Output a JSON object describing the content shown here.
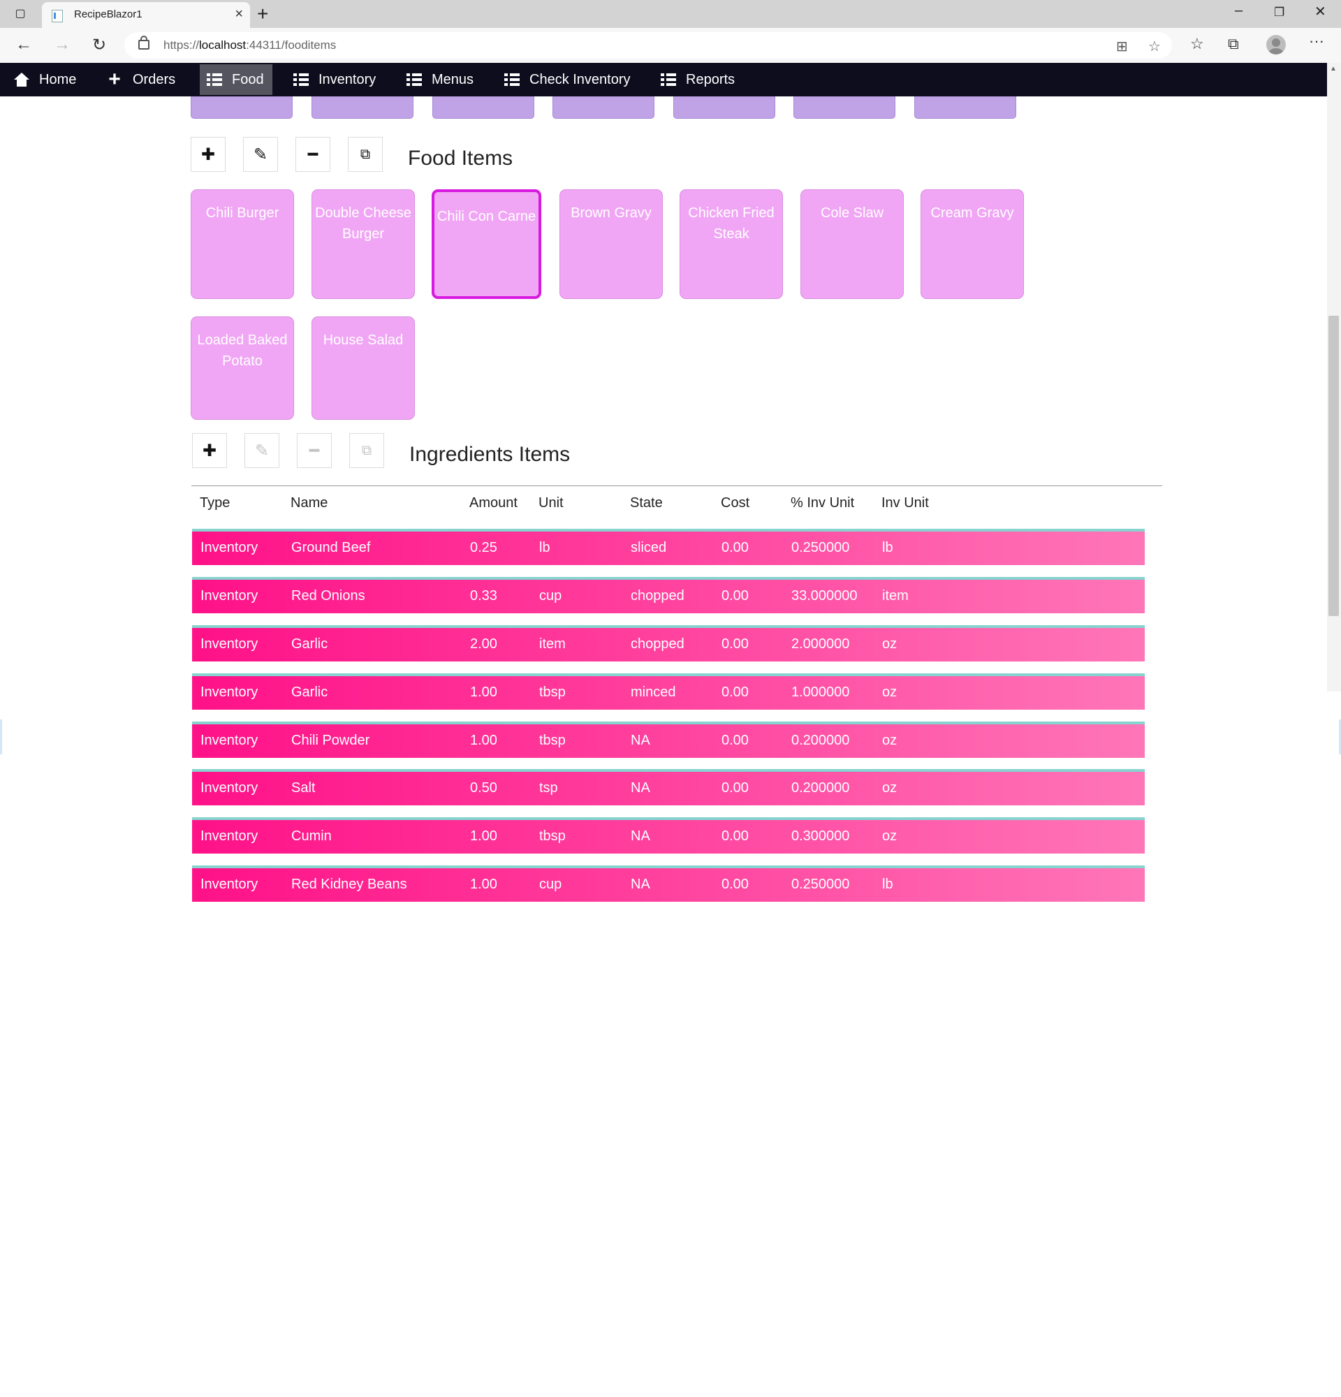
{
  "browser": {
    "tab_title": "RecipeBlazor1",
    "url_prefix": "https://",
    "url_host": "localhost",
    "url_rest": ":44311/fooditems"
  },
  "nav": {
    "items": [
      {
        "label": "Home",
        "icon": "home-icon"
      },
      {
        "label": "Orders",
        "icon": "plus-icon"
      },
      {
        "label": "Food",
        "icon": "list-icon",
        "active": true
      },
      {
        "label": "Inventory",
        "icon": "list-icon"
      },
      {
        "label": "Menus",
        "icon": "list-icon"
      },
      {
        "label": "Check Inventory",
        "icon": "list-icon"
      },
      {
        "label": "Reports",
        "icon": "list-icon"
      }
    ]
  },
  "food_section": {
    "title": "Food Items",
    "tiles": [
      {
        "label": "Chili Burger"
      },
      {
        "label": "Double Cheese Burger"
      },
      {
        "label": "Chili Con Carne",
        "selected": true
      },
      {
        "label": "Brown Gravy"
      },
      {
        "label": "Chicken Fried Steak"
      },
      {
        "label": "Cole Slaw"
      },
      {
        "label": "Cream Gravy"
      },
      {
        "label": "Loaded Baked Potato"
      },
      {
        "label": "House Salad"
      }
    ]
  },
  "ingredients_section": {
    "title": "Ingredients Items",
    "columns": [
      "Type",
      "Name",
      "Amount",
      "Unit",
      "State",
      "Cost",
      "% Inv Unit",
      "Inv Unit"
    ],
    "rows": [
      [
        "Inventory",
        "Ground Beef",
        "0.25",
        "lb",
        "sliced",
        "0.00",
        "0.250000",
        "lb"
      ],
      [
        "Inventory",
        "Red Onions",
        "0.33",
        "cup",
        "chopped",
        "0.00",
        "33.000000",
        "item"
      ],
      [
        "Inventory",
        "Garlic",
        "2.00",
        "item",
        "chopped",
        "0.00",
        "2.000000",
        "oz"
      ],
      [
        "Inventory",
        "Garlic",
        "1.00",
        "tbsp",
        "minced",
        "0.00",
        "1.000000",
        "oz"
      ],
      [
        "Inventory",
        "Chili Powder",
        "1.00",
        "tbsp",
        "NA",
        "0.00",
        "0.200000",
        "oz"
      ],
      [
        "Inventory",
        "Salt",
        "0.50",
        "tsp",
        "NA",
        "0.00",
        "0.200000",
        "oz"
      ],
      [
        "Inventory",
        "Cumin",
        "1.00",
        "tbsp",
        "NA",
        "0.00",
        "0.300000",
        "oz"
      ],
      [
        "Inventory",
        "Red Kidney Beans",
        "1.00",
        "cup",
        "NA",
        "0.00",
        "0.250000",
        "lb"
      ]
    ]
  },
  "colors": {
    "nav_bg": "#0d0d1e",
    "food_tile": "#f0a6f4",
    "food_tile_selected_border": "#d81ae0",
    "category_tile": "#c0a2e6",
    "row_start": "#ff1188",
    "row_end": "#ff76b8",
    "row_top_border": "#86d3cf"
  }
}
